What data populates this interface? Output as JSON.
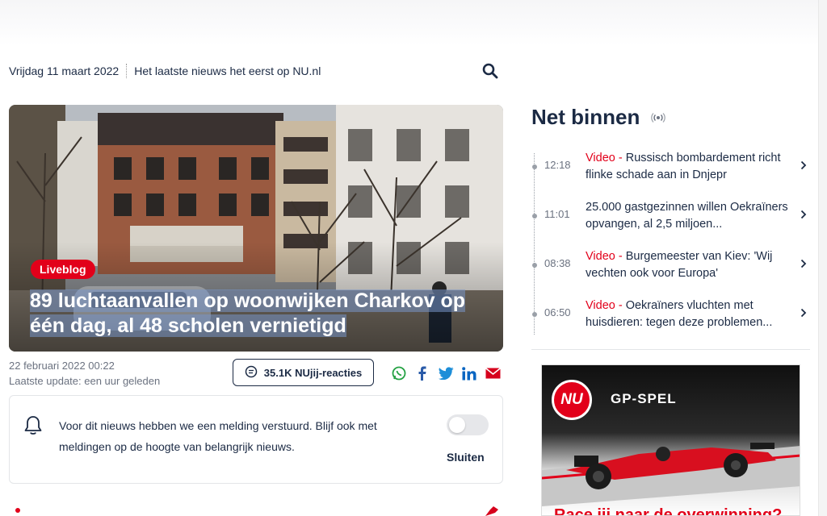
{
  "header": {
    "date": "Vrijdag 11 maart 2022",
    "tagline": "Het laatste nieuws het eerst op NU.nl",
    "search_icon": "search-icon"
  },
  "article": {
    "badge": "Liveblog",
    "headline_line1": "89 luchtaanvallen op woonwijken Charkov op",
    "headline_line2": "één dag, al 48 scholen vernietigd",
    "published": "22 februari 2022 00:22",
    "updated": "Laatste update: een uur geleden",
    "reactions_label": "35.1K NUjij-reacties",
    "share_icons": [
      "whatsapp-icon",
      "facebook-icon",
      "twitter-icon",
      "linkedin-icon",
      "email-icon"
    ]
  },
  "notification": {
    "text": "Voor dit nieuws hebben we een melding verstuurd. Blijf ook met meldingen op de hoogte van belangrijk nieuws.",
    "toggle_on": false,
    "close_label": "Sluiten"
  },
  "net_binnen": {
    "title": "Net binnen",
    "items": [
      {
        "time": "12:18",
        "tag": "Video",
        "title": "Russisch bombardement richt flinke schade aan in Dnjepr"
      },
      {
        "time": "11:01",
        "tag": "",
        "title": "25.000 gastgezinnen willen Oekraïners opvangen, al 2,5 miljoen..."
      },
      {
        "time": "08:38",
        "tag": "Video",
        "title": "Burgemeester van Kiev: 'Wij vechten ook voor Europa'"
      },
      {
        "time": "06:50",
        "tag": "Video",
        "title": "Oekraïners vluchten met huisdieren: tegen deze problemen..."
      }
    ]
  },
  "ad": {
    "logo_text": "NU",
    "brand": "GP-SPEL",
    "cta": "Race jij naar de overwinning?"
  },
  "colors": {
    "accent": "#e2001a",
    "navy": "#1b2a44"
  }
}
